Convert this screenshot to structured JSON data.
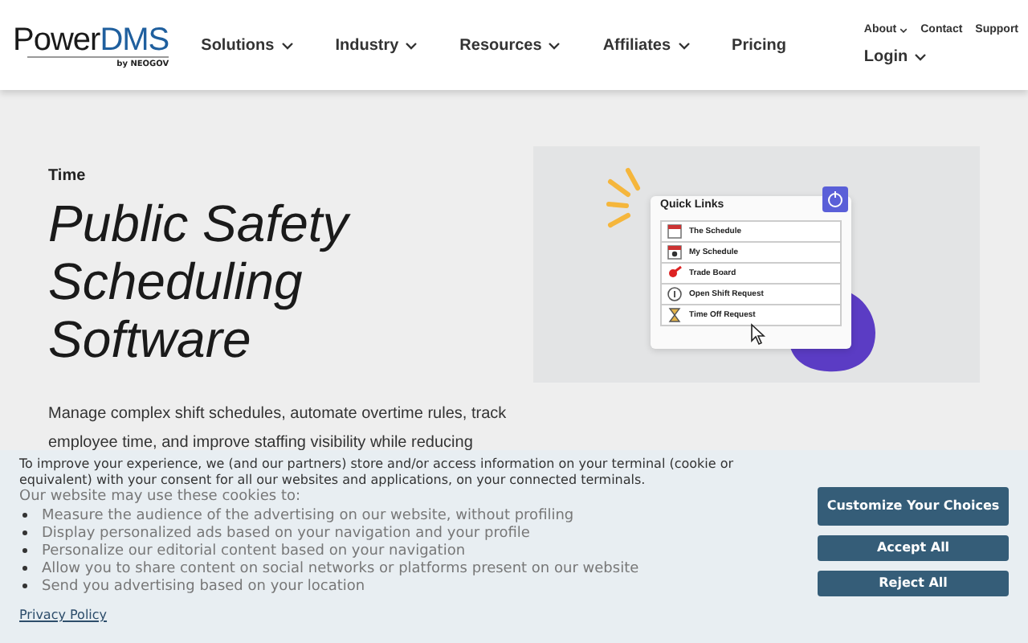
{
  "header": {
    "logo": {
      "main": "Power",
      "accent": "DMS",
      "tagline": "by NEOGOV"
    },
    "nav": [
      {
        "label": "Solutions",
        "dropdown": true
      },
      {
        "label": "Industry",
        "dropdown": true
      },
      {
        "label": "Resources",
        "dropdown": true
      },
      {
        "label": "Affiliates",
        "dropdown": true
      },
      {
        "label": "Pricing",
        "dropdown": false
      }
    ],
    "utility": [
      {
        "label": "About",
        "dropdown": true
      },
      {
        "label": "Contact",
        "dropdown": false
      },
      {
        "label": "Support",
        "dropdown": false
      }
    ],
    "login": {
      "label": "Login",
      "dropdown": true
    }
  },
  "hero": {
    "eyebrow": "Time",
    "title": [
      "Public Safety",
      "Scheduling",
      "Software"
    ],
    "description": "Manage complex shift schedules, automate overtime rules, track employee time, and improve staffing visibility while reducing"
  },
  "illustration": {
    "card_title": "Quick Links",
    "links": [
      {
        "label": "The Schedule",
        "kind": "calendar"
      },
      {
        "label": "My Schedule",
        "kind": "person-calendar"
      },
      {
        "label": "Trade Board",
        "kind": "pin"
      },
      {
        "label": "Open Shift Request",
        "kind": "info"
      },
      {
        "label": "Time Off Request",
        "kind": "hourglass"
      }
    ]
  },
  "cookie_banner": {
    "intro": "To improve your experience, we (and our partners) store and/or access information on your terminal (cookie or equivalent) with your consent for all our websites and applications, on your connected terminals.",
    "lead": "Our website may use these cookies to:",
    "purposes": [
      "Measure the audience of the advertising on our website, without profiling",
      "Display personalized ads based on your navigation and your profile",
      "Personalize our editorial content based on your navigation",
      "Allow you to share content on social networks or platforms present on our website",
      "Send you advertising based on your location"
    ],
    "privacy_link": "Privacy Policy",
    "buttons": [
      "Customize Your Choices",
      "Accept All",
      "Reject All"
    ]
  }
}
